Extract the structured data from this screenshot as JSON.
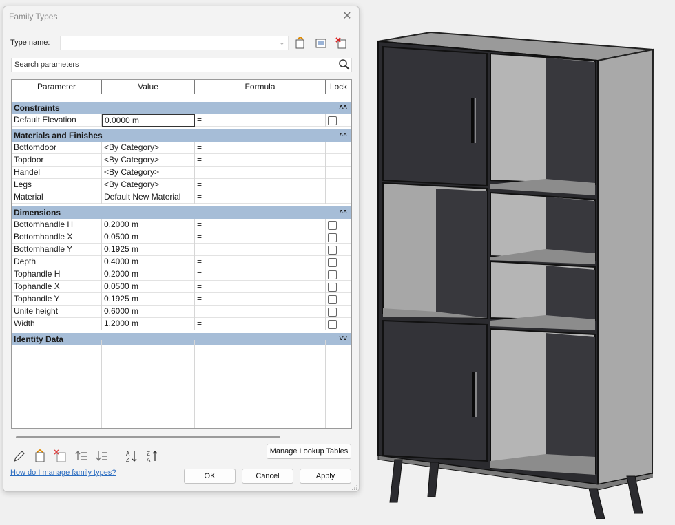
{
  "dialog": {
    "title": "Family Types",
    "close_glyph": "✕",
    "type_name_label": "Type name:",
    "type_name_value": "",
    "search_placeholder": "Search parameters",
    "help_link": "How do I manage family types?",
    "manage_lookup_label": "Manage Lookup Tables",
    "ok_label": "OK",
    "cancel_label": "Cancel",
    "apply_label": "Apply"
  },
  "table": {
    "headers": {
      "parameter": "Parameter",
      "value": "Value",
      "formula": "Formula",
      "lock": "Lock"
    },
    "groups": [
      {
        "name": "Constraints",
        "collapse_glyph": "˄˄",
        "rows": [
          {
            "parameter": "Default Elevation",
            "value": "0.0000 m",
            "formula": "=",
            "lock": true
          }
        ]
      },
      {
        "name": "Materials and Finishes",
        "collapse_glyph": "˄˄",
        "rows": [
          {
            "parameter": "Bottomdoor",
            "value": "<By Category>",
            "formula": "=",
            "lock": false
          },
          {
            "parameter": "Topdoor",
            "value": "<By Category>",
            "formula": "=",
            "lock": false
          },
          {
            "parameter": "Handel",
            "value": "<By Category>",
            "formula": "=",
            "lock": false
          },
          {
            "parameter": "Legs",
            "value": "<By Category>",
            "formula": "=",
            "lock": false
          },
          {
            "parameter": "Material",
            "value": "Default New Material",
            "formula": "=",
            "lock": false
          }
        ]
      },
      {
        "name": "Dimensions",
        "collapse_glyph": "˄˄",
        "rows": [
          {
            "parameter": "Bottomhandle H",
            "value": "0.2000 m",
            "formula": "=",
            "lock": true
          },
          {
            "parameter": "Bottomhandle X",
            "value": "0.0500 m",
            "formula": "=",
            "lock": true
          },
          {
            "parameter": "Bottomhandle Y",
            "value": "0.1925 m",
            "formula": "=",
            "lock": true
          },
          {
            "parameter": "Depth",
            "value": "0.4000 m",
            "formula": "=",
            "lock": true
          },
          {
            "parameter": "Tophandle H",
            "value": "0.2000 m",
            "formula": "=",
            "lock": true
          },
          {
            "parameter": "Tophandle X",
            "value": "0.0500 m",
            "formula": "=",
            "lock": true
          },
          {
            "parameter": "Tophandle Y",
            "value": "0.1925 m",
            "formula": "=",
            "lock": true
          },
          {
            "parameter": "Unite height",
            "value": "0.6000 m",
            "formula": "=",
            "lock": true
          },
          {
            "parameter": "Width",
            "value": "1.2000 m",
            "formula": "=",
            "lock": true
          }
        ]
      },
      {
        "name": "Identity Data",
        "collapse_glyph": "˅˅",
        "rows": []
      }
    ]
  },
  "colors": {
    "group_header": "#a6bdd7",
    "cabinet_dark": "#2e2e33",
    "cabinet_mid": "#8c8c8c",
    "cabinet_light": "#b3b3b3",
    "link": "#2a6cc0"
  },
  "icons": {
    "new_type": "new-type-icon",
    "rename_type": "rename-type-icon",
    "delete_type": "delete-type-icon",
    "search": "search-icon",
    "edit_parameter": "pencil-icon",
    "new_parameter": "new-parameter-icon",
    "delete_parameter": "delete-parameter-icon",
    "move_up": "move-up-icon",
    "move_down": "move-down-icon",
    "sort_ascending": "sort-ascending-icon",
    "sort_descending": "sort-descending-icon"
  }
}
